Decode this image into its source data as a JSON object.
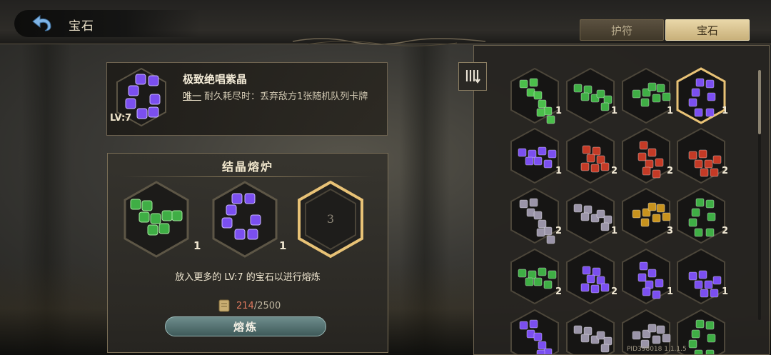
{
  "header": {
    "title": "宝石"
  },
  "tabs": [
    {
      "label": "护符",
      "active": false
    },
    {
      "label": "宝石",
      "active": true
    }
  ],
  "selected_gem": {
    "name": "极致绝唱紫晶",
    "level": "LV:7",
    "unique_label": "唯一",
    "effect": "耐久耗尽时：丢弃敌方1张随机队列卡牌",
    "color": "#7b4ff0"
  },
  "furnace": {
    "title": "结晶熔炉",
    "slots": [
      {
        "gem_color": "green",
        "count": "1"
      },
      {
        "gem_color": "purple",
        "count": "1"
      },
      {
        "empty_label": "3"
      }
    ],
    "hint": "放入更多的 LV:7 的宝石以进行熔炼",
    "cost_current": "214",
    "cost_total": "/2500",
    "smelt_button": "熔炼"
  },
  "inventory": {
    "items": [
      {
        "color": "#4bbf4b",
        "count": "1"
      },
      {
        "color": "#3fae45",
        "count": "1"
      },
      {
        "color": "#3fae45",
        "count": "1"
      },
      {
        "color": "#7b4ff0",
        "count": "1",
        "selected": true
      },
      {
        "color": "#7b4ff0",
        "count": "1"
      },
      {
        "color": "#c43a26",
        "count": "2"
      },
      {
        "color": "#c43a26",
        "count": "2"
      },
      {
        "color": "#c43a26",
        "count": "2"
      },
      {
        "color": "#9a94a8",
        "count": "2"
      },
      {
        "color": "#9a94a8",
        "count": "1"
      },
      {
        "color": "#c8931e",
        "count": "3"
      },
      {
        "color": "#3fae45",
        "count": "2"
      },
      {
        "color": "#3fae45",
        "count": "2"
      },
      {
        "color": "#7b4ff0",
        "count": "2"
      },
      {
        "color": "#7b4ff0",
        "count": "1"
      },
      {
        "color": "#7b4ff0",
        "count": "1"
      },
      {
        "color": "#7b4ff0",
        "count": ""
      },
      {
        "color": "#9a94a8",
        "count": ""
      },
      {
        "color": "#9a94a8",
        "count": ""
      },
      {
        "color": "#3fae45",
        "count": ""
      }
    ]
  },
  "footer": {
    "pid": "PID398018  1.1.1.5"
  },
  "colors": {
    "accent_gold": "#e8c276",
    "tab_active": "#d8c28e",
    "button_teal": "#55706f"
  }
}
